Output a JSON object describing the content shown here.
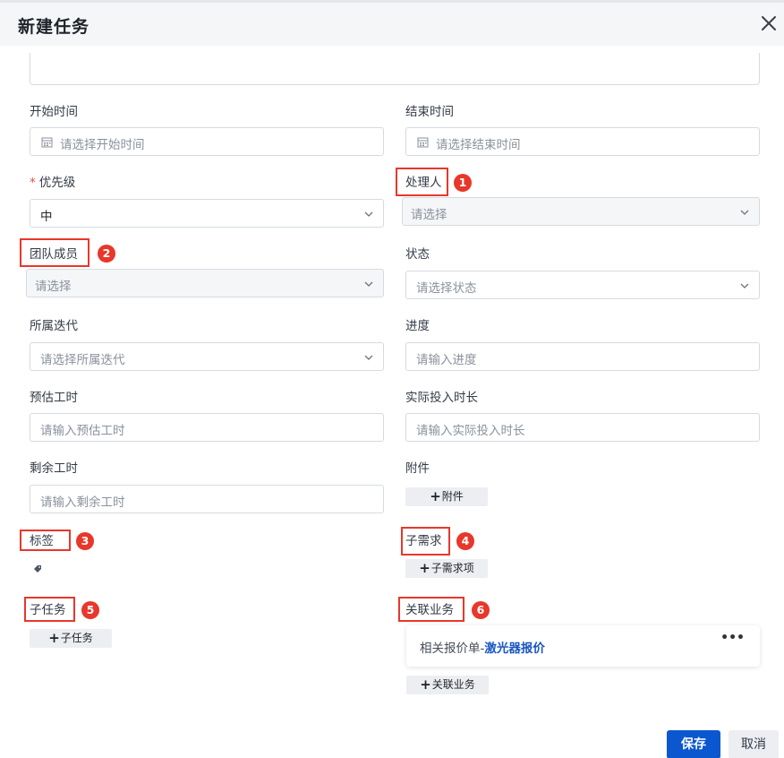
{
  "dialog": {
    "title": "新建任务"
  },
  "fields": {
    "start_time": {
      "label": "开始时间",
      "placeholder": "请选择开始时间"
    },
    "end_time": {
      "label": "结束时间",
      "placeholder": "请选择结束时间"
    },
    "priority": {
      "label": "优先级",
      "required_mark": "*",
      "value": "中"
    },
    "assignee": {
      "label": "处理人",
      "placeholder": "请选择"
    },
    "team_members": {
      "label": "团队成员",
      "placeholder": "请选择"
    },
    "status": {
      "label": "状态",
      "placeholder": "请选择状态"
    },
    "iteration": {
      "label": "所属迭代",
      "placeholder": "请选择所属迭代"
    },
    "progress": {
      "label": "进度",
      "placeholder": "请输入进度"
    },
    "estimated_hours": {
      "label": "预估工时",
      "placeholder": "请输入预估工时"
    },
    "actual_hours": {
      "label": "实际投入时长",
      "placeholder": "请输入实际投入时长"
    },
    "remaining_hours": {
      "label": "剩余工时",
      "placeholder": "请输入剩余工时"
    },
    "attachments": {
      "label": "附件",
      "button": "附件"
    },
    "tags": {
      "label": "标签"
    },
    "sub_requirements": {
      "label": "子需求",
      "button": "子需求项"
    },
    "sub_tasks": {
      "label": "子任务",
      "button": "子任务"
    },
    "related_business": {
      "label": "关联业务",
      "button": "关联业务",
      "item_prefix": "相关报价单-",
      "item_link": "激光器报价",
      "more": "•••"
    }
  },
  "annotations": {
    "badges": [
      "1",
      "2",
      "3",
      "4",
      "5",
      "6"
    ],
    "color": "#e8372b"
  },
  "buttons": {
    "plus": "+",
    "save": "保存",
    "cancel": "取消"
  },
  "colors": {
    "primary": "#0b57d0",
    "link": "#1a56c2",
    "required": "#e34d3d",
    "annotation": "#e8372b"
  },
  "icons": {
    "close": "close-icon",
    "calendar": "calendar-icon",
    "chevron": "chevron-down-icon",
    "tag": "tag-icon"
  }
}
